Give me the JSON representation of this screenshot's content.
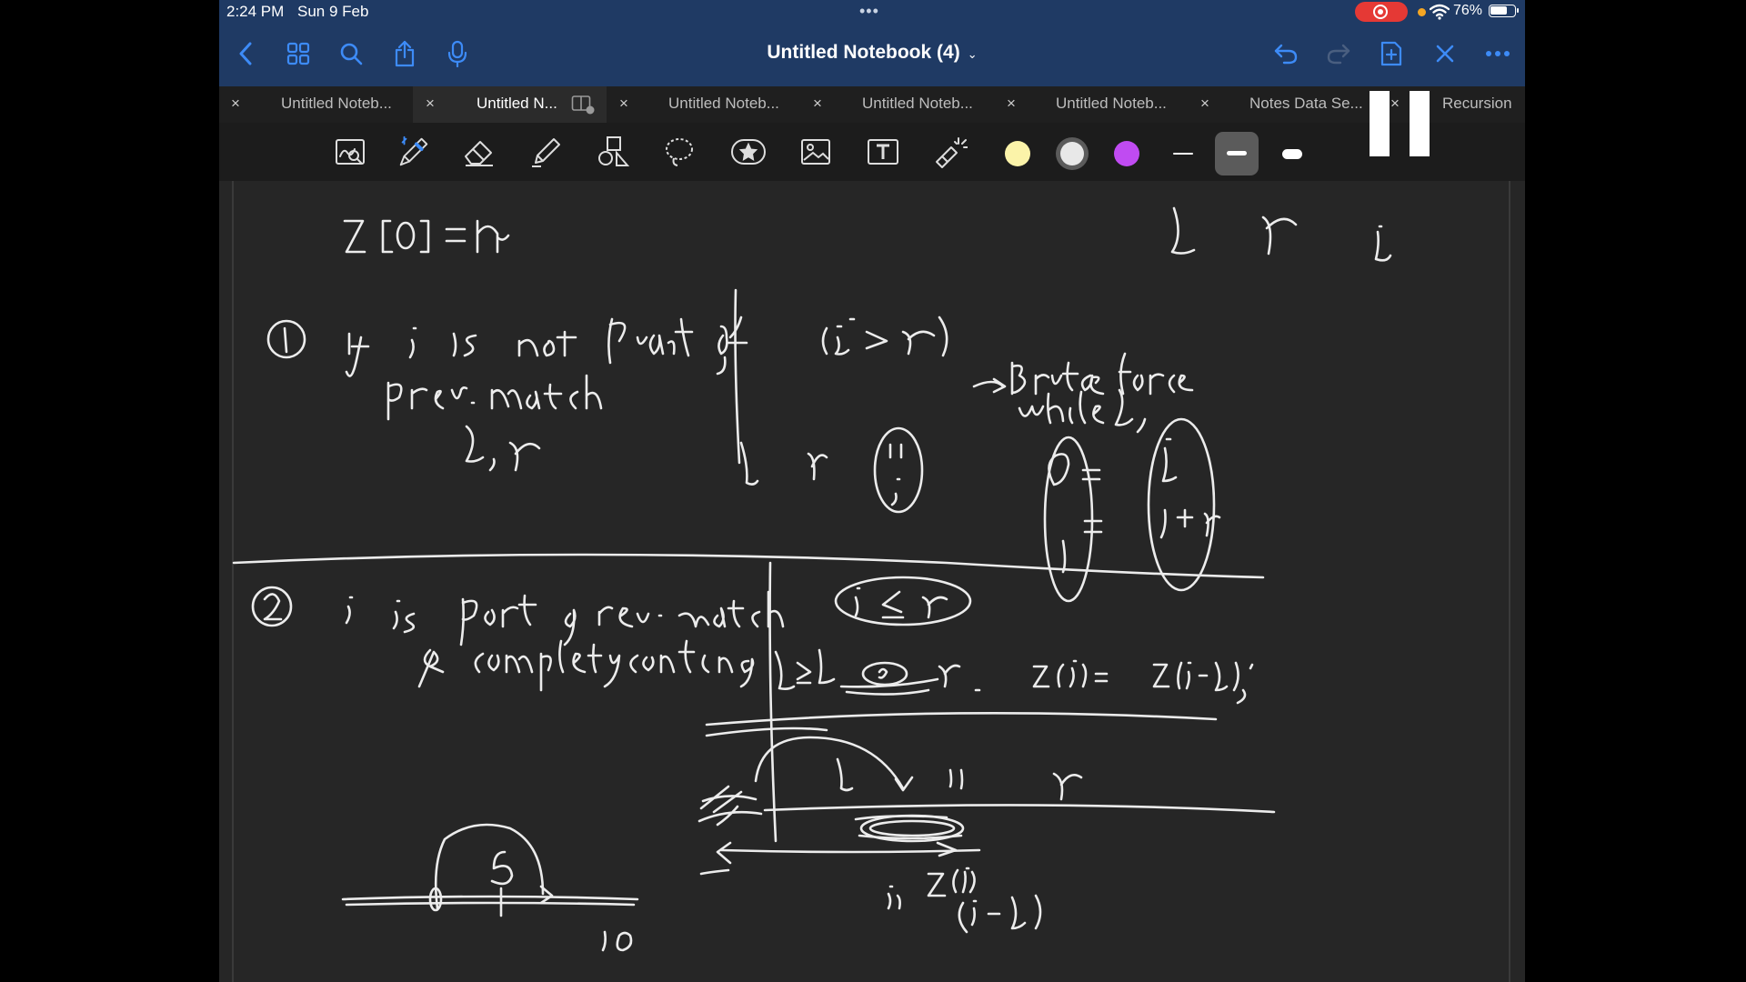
{
  "status": {
    "time": "2:24 PM",
    "date": "Sun 9 Feb",
    "dots": "•••",
    "battery": "76%",
    "battery_level": 0.76
  },
  "nav": {
    "title": "Untitled Notebook (4)",
    "title_chevron": "⌄"
  },
  "tabs": [
    {
      "label": "Untitled Noteb...",
      "close": "×",
      "active": false
    },
    {
      "label": "Untitled N...",
      "close": "×",
      "active": true
    },
    {
      "label": "Untitled Noteb...",
      "close": "×",
      "active": false
    },
    {
      "label": "Untitled Noteb...",
      "close": "×",
      "active": false
    },
    {
      "label": "Untitled Noteb...",
      "close": "×",
      "active": false
    },
    {
      "label": "Notes Data Se...",
      "close": "×",
      "active": false
    },
    {
      "label": "Recursion",
      "close": "×",
      "active": false
    }
  ],
  "toolbar": {
    "tools": [
      "zoom-window-icon",
      "pen-icon",
      "eraser-icon",
      "highlighter-icon",
      "shapes-icon",
      "lasso-icon",
      "sticker-icon",
      "image-icon",
      "text-icon",
      "laser-pointer-icon"
    ],
    "colors": [
      "#fbf3a9",
      "#e8e8e8",
      "#c04bf2"
    ],
    "selected_color": "#e8e8e8",
    "selected_stroke": 1
  },
  "colors": {
    "header_bg": "#1f3a64",
    "accent": "#3d8bf7",
    "canvas_bg": "#262626",
    "ink": "#ececec"
  }
}
